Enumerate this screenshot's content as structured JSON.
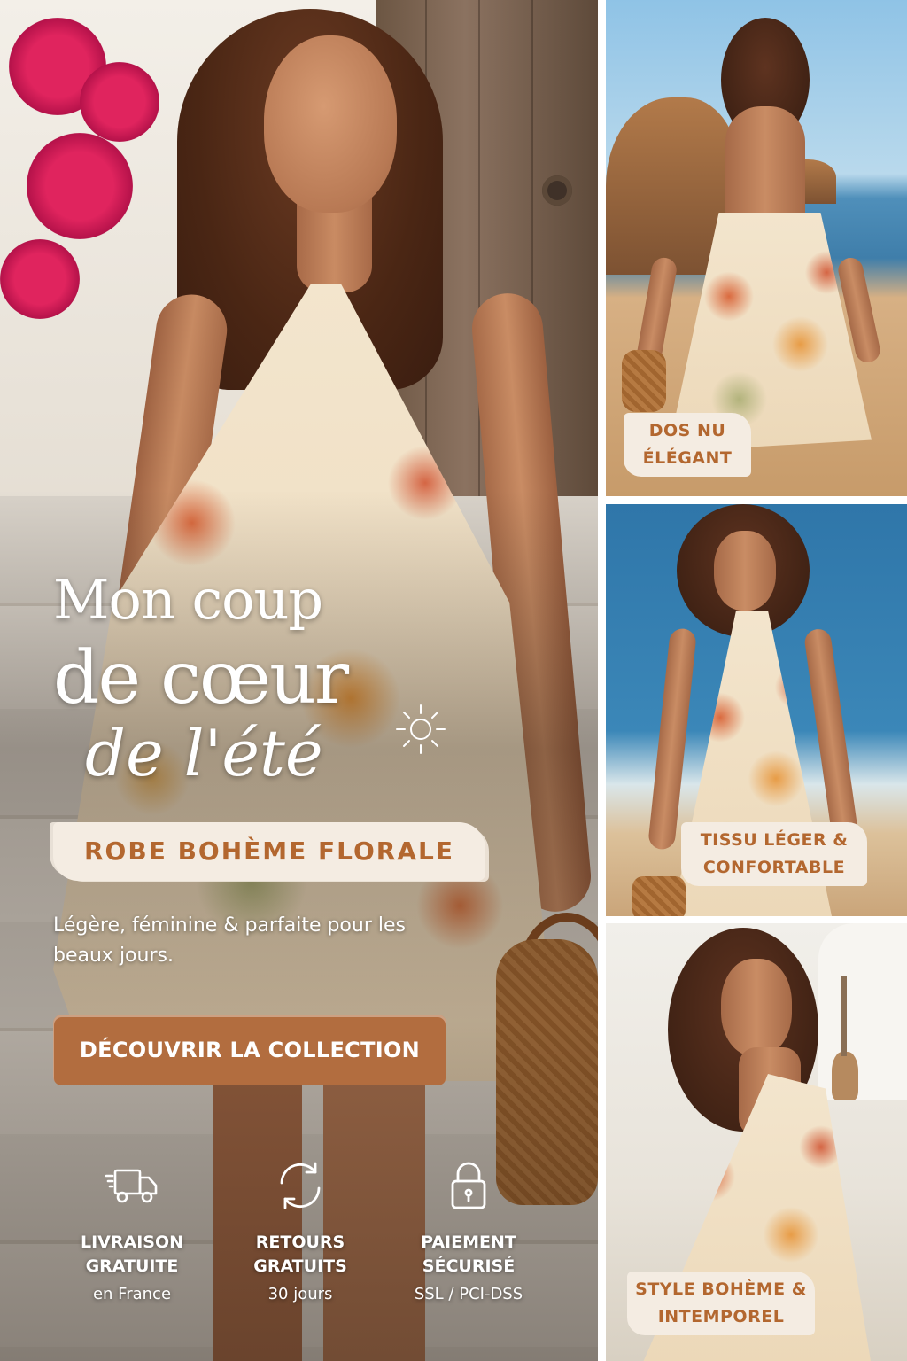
{
  "hero": {
    "headline_line1": "Mon coup",
    "headline_line2": "de cœur",
    "headline_line3": "de l'été",
    "product_label": "ROBE BOHÈME FLORALE",
    "subtitle": "Légère, féminine & parfaite pour les beaux jours.",
    "cta_label": "DÉCOUVRIR LA COLLECTION",
    "icons": [
      "sun-icon"
    ]
  },
  "features": [
    {
      "icon": "truck-icon",
      "title": "LIVRAISON GRATUITE",
      "subtitle": "en France"
    },
    {
      "icon": "refresh-icon",
      "title": "RETOURS GRATUITS",
      "subtitle": "30 jours"
    },
    {
      "icon": "lock-icon",
      "title": "PAIEMENT SÉCURISÉ",
      "subtitle": "SSL / PCI-DSS"
    }
  ],
  "gallery": [
    {
      "label": "DOS NU ÉLÉGANT"
    },
    {
      "label": "TISSU LÉGER & CONFORTABLE"
    },
    {
      "label": "STYLE BOHÈME & INTEMPOREL"
    }
  ],
  "colors": {
    "accent": "#b26d3f",
    "label_text": "#b3672f",
    "label_bg": "#f4ece2"
  }
}
